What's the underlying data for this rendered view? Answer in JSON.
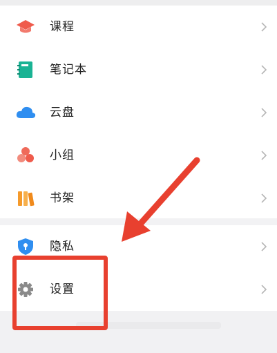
{
  "menu_group_1": [
    {
      "label": "课程",
      "icon": "graduation-cap-icon",
      "color": "#ef5b4c"
    },
    {
      "label": "笔记本",
      "icon": "notebook-icon",
      "color": "#1ab394"
    },
    {
      "label": "云盘",
      "icon": "cloud-icon",
      "color": "#2f8ef0"
    },
    {
      "label": "小组",
      "icon": "group-icon",
      "color": "#ef6a5a"
    },
    {
      "label": "书架",
      "icon": "bookshelf-icon",
      "color": "#f59a2b"
    }
  ],
  "menu_group_2": [
    {
      "label": "隐私",
      "icon": "shield-icon",
      "color": "#2f8ef0"
    },
    {
      "label": "设置",
      "icon": "gear-icon",
      "color": "#8a8a8a"
    }
  ],
  "annotation": {
    "color": "#e8402f"
  }
}
